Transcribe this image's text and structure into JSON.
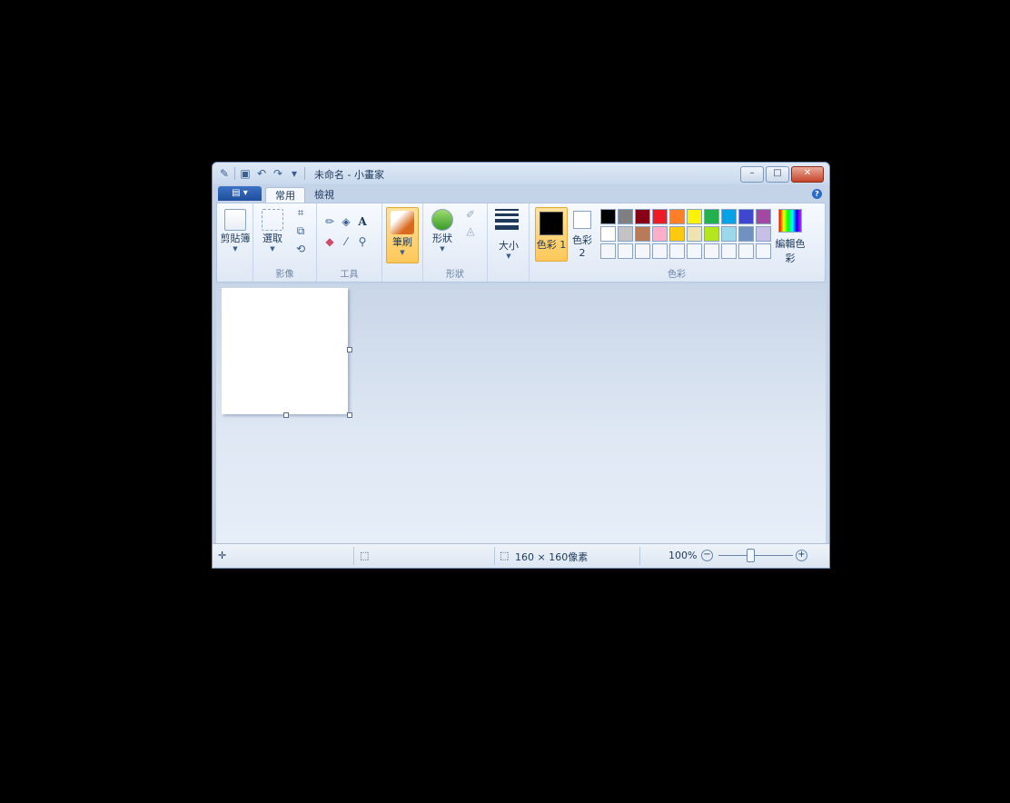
{
  "window": {
    "title": "未命名 - 小畫家"
  },
  "tabs": {
    "home": "常用",
    "view": "檢視"
  },
  "ribbon": {
    "clipboard_label": "剪貼簿",
    "select_label": "選取",
    "image_group": "影像",
    "tools_group": "工具",
    "brush_label": "筆刷",
    "shapes_label": "形狀",
    "shapes_group": "形狀",
    "size_label": "大小",
    "color1_label": "色彩 1",
    "color2_label": "色彩 2",
    "edit_colors_label": "編輯色彩",
    "colors_group": "色彩"
  },
  "palette": {
    "row1": [
      "#000000",
      "#7f7f7f",
      "#880015",
      "#ed1c24",
      "#ff7f27",
      "#fff200",
      "#22b14c",
      "#00a2e8",
      "#3f48cc",
      "#a349a4"
    ],
    "row2": [
      "#ffffff",
      "#c3c3c3",
      "#b97a57",
      "#ffaec9",
      "#ffc90e",
      "#efe4b0",
      "#b5e61d",
      "#99d9ea",
      "#7092be",
      "#c8bfe7"
    ],
    "row3": [
      "#f3f6fb",
      "#f3f6fb",
      "#f3f6fb",
      "#f3f6fb",
      "#f3f6fb",
      "#f3f6fb",
      "#f3f6fb",
      "#f3f6fb",
      "#f3f6fb",
      "#f3f6fb"
    ]
  },
  "status": {
    "move_icon": "move-cursor-icon",
    "selection_icon": "selection-size-icon",
    "canvas_size": "160 × 160像素",
    "zoom": "100%"
  }
}
